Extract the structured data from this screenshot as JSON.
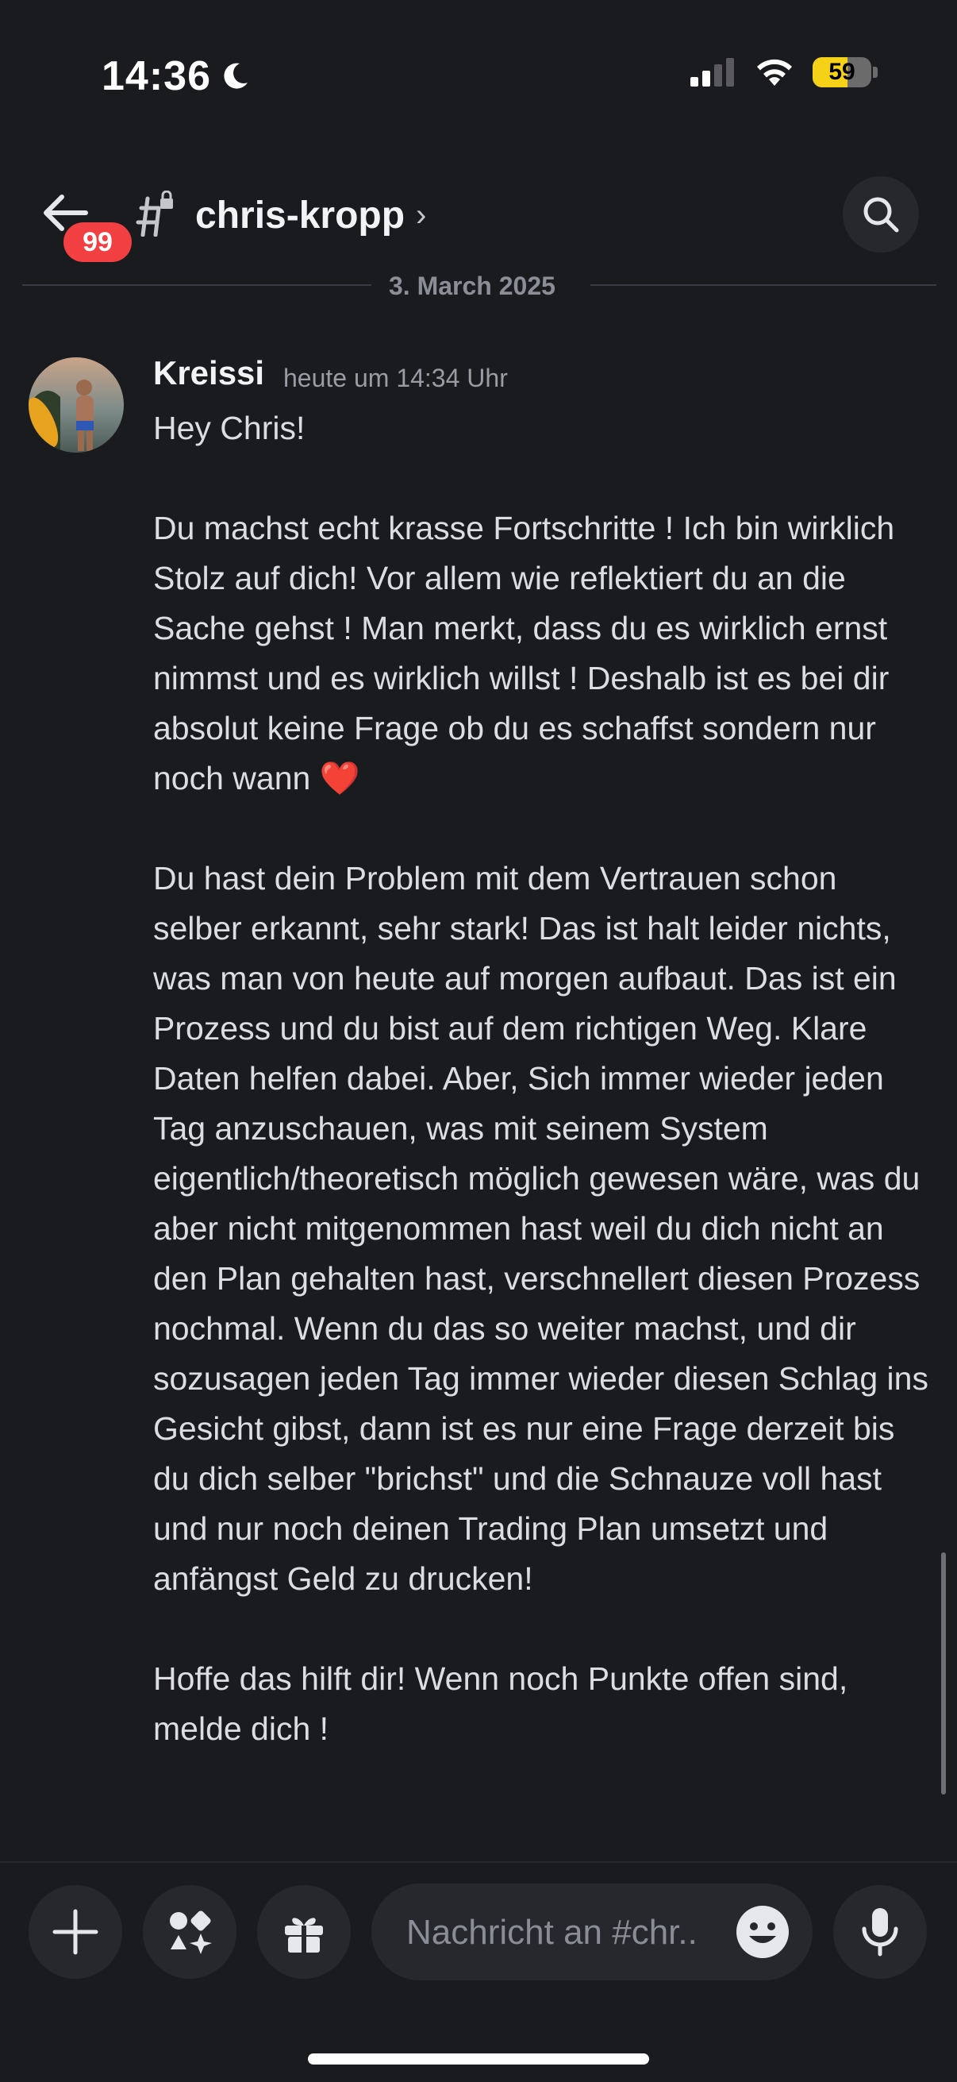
{
  "status_bar": {
    "time": "14:36",
    "battery": "59",
    "battery_level": 0.59
  },
  "header": {
    "back_badge": "99",
    "channel_name": "chris-kropp",
    "chevron": "›"
  },
  "date_divider": "3. March 2025",
  "message": {
    "author": "Kreissi",
    "timestamp": "heute um 14:34 Uhr",
    "paragraphs": [
      "Hey Chris!",
      "Du machst echt krasse Fortschritte ! Ich bin wirklich Stolz auf dich! Vor allem wie reflektiert du an die Sache gehst ! Man merkt, dass du es wirklich ernst nimmst und es wirklich willst ! Deshalb ist es bei dir absolut keine Frage ob du es schaffst sondern nur noch wann",
      "Du hast dein Problem mit dem Vertrauen schon selber erkannt, sehr stark! Das ist halt leider nichts, was man von heute auf morgen aufbaut. Das ist ein Prozess und du bist auf dem richtigen Weg. Klare Daten helfen dabei. Aber, Sich immer wieder jeden Tag anzuschauen, was mit seinem System eigentlich/theoretisch möglich gewesen wäre, was du aber nicht mitgenommen hast weil du dich nicht an den Plan gehalten hast, verschnellert diesen Prozess nochmal. Wenn du das so weiter machst, und dir sozusagen jeden Tag immer wieder diesen Schlag ins Gesicht gibst, dann ist es nur eine Frage derzeit bis du dich selber \"brichst\" und die Schnauze voll hast und nur noch deinen Trading Plan umsetzt und anfängst Geld zu drucken!",
      "Hoffe das hilft dir! Wenn noch Punkte offen sind, melde dich !"
    ],
    "heart_emoji": "❤️"
  },
  "composer": {
    "placeholder": "Nachricht an #chr.."
  },
  "colors": {
    "background": "#1a1b1f",
    "badge": "#f23f42",
    "battery": "#f5d117",
    "heart": "#f0223b"
  },
  "icons": [
    "moon-icon",
    "signal-icon",
    "wifi-icon",
    "battery-icon",
    "back-arrow-icon",
    "locked-channel-icon",
    "search-icon",
    "plus-icon",
    "apps-icon",
    "gift-icon",
    "emoji-icon",
    "microphone-icon"
  ]
}
